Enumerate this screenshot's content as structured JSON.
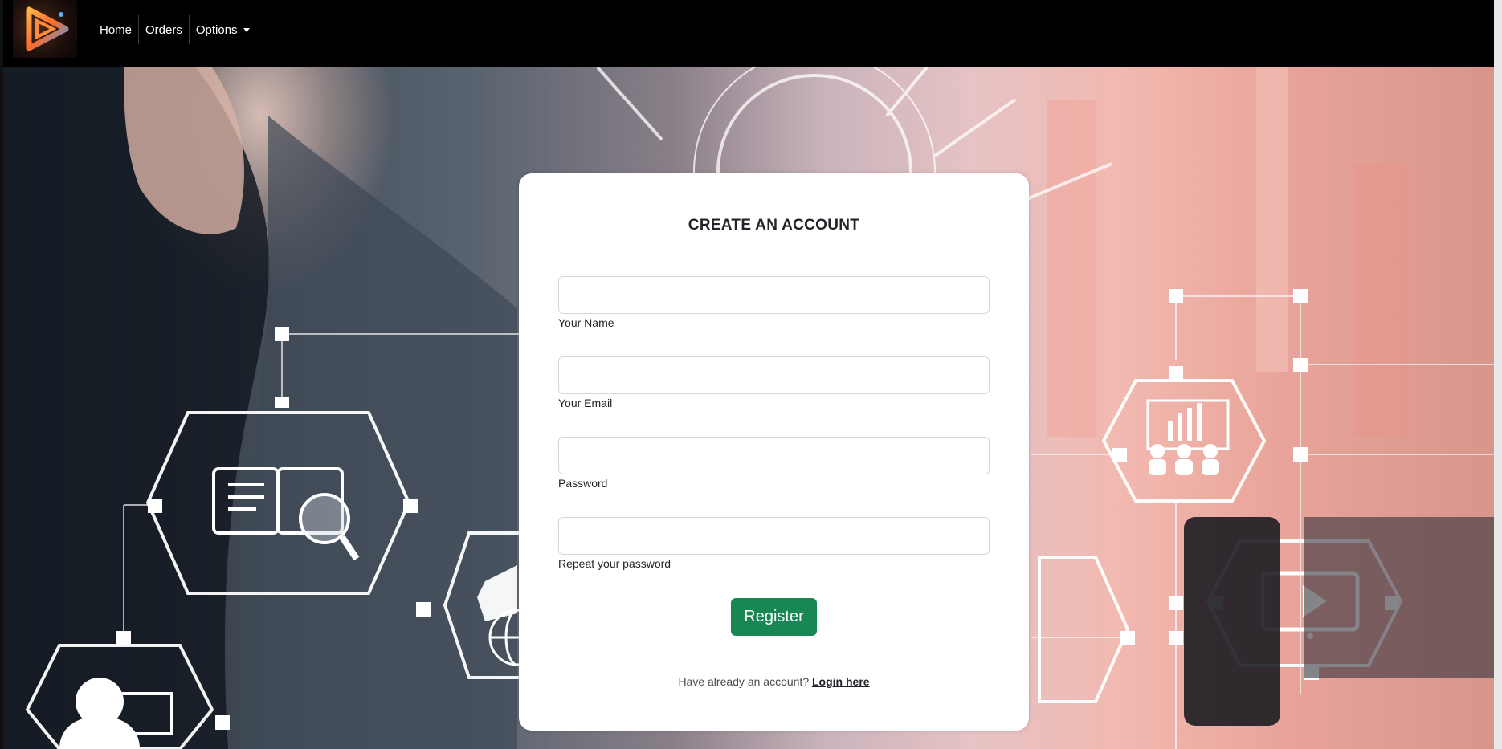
{
  "nav": {
    "items": [
      {
        "label": "Home"
      },
      {
        "label": "Orders"
      },
      {
        "label": "Options"
      }
    ]
  },
  "form": {
    "title": "CREATE AN ACCOUNT",
    "fields": [
      {
        "label": "Your Name",
        "value": "",
        "placeholder": ""
      },
      {
        "label": "Your Email",
        "value": "",
        "placeholder": ""
      },
      {
        "label": "Password",
        "value": "",
        "placeholder": ""
      },
      {
        "label": "Repeat your password",
        "value": "",
        "placeholder": ""
      }
    ],
    "submit_label": "Register",
    "login_prompt": "Have already an account?",
    "login_link": "Login here"
  },
  "colors": {
    "navbar": "#000000",
    "register_button": "#198754"
  },
  "icons": [
    "brand-logo-icon",
    "chevron-down-icon",
    "book-search-icon",
    "graduation-cap-icon",
    "globe-icon",
    "presentation-team-icon",
    "video-play-icon",
    "user-profile-icon"
  ]
}
